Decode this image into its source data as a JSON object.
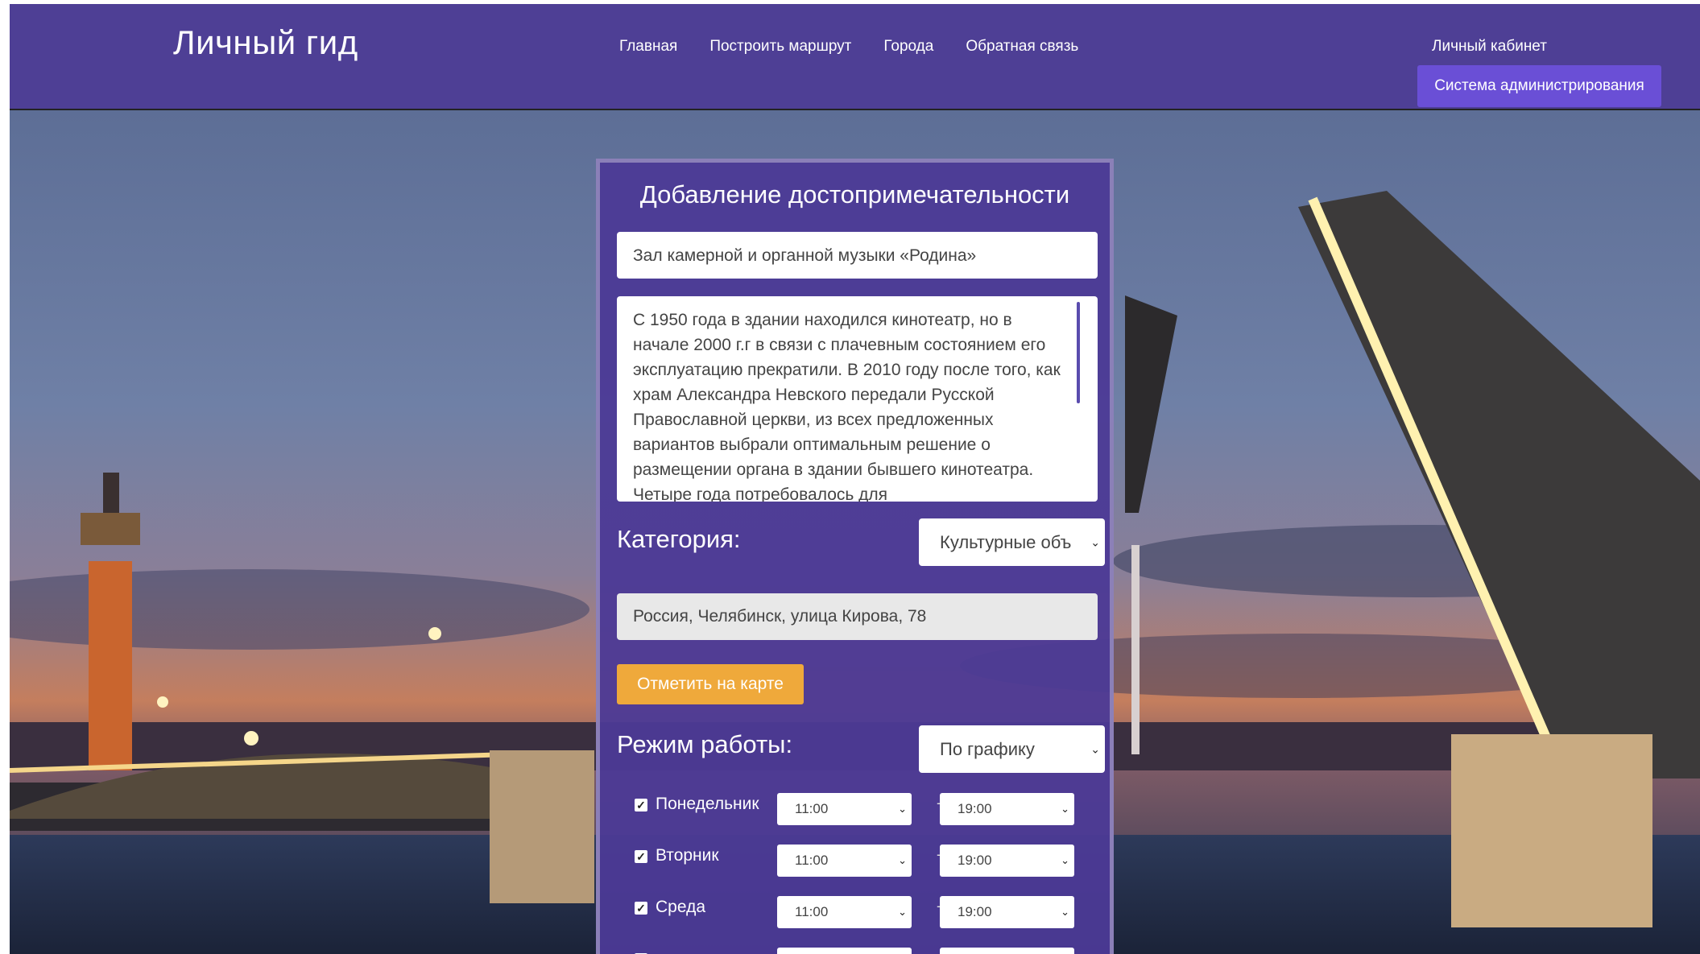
{
  "header": {
    "logo": "Личный гид",
    "nav": [
      "Главная",
      "Построить маршрут",
      "Города",
      "Обратная связь"
    ],
    "cabinet": "Личный кабинет",
    "admin_button": "Система администрирования"
  },
  "form": {
    "title": "Добавление достопримечательности",
    "name_value": "Зал камерной и органной музыки «Родина»",
    "description": "С 1950 года в здании находился кинотеатр, но в начале 2000 г.г в связи с плачевным состоянием его эксплуатацию прекратили. В 2010 году после того, как храм Александра Невского передали Русской Православной церкви, из всех предложенных вариантов выбрали оптимальным решение о размещении органа в здании бывшего кинотеатра. Четыре года потребовалось для",
    "category_label": "Категория:",
    "category_value": "Культурные объ",
    "address_value": "Россия, Челябинск, улица Кирова, 78",
    "map_button": "Отметить на карте",
    "work_label": "Режим работы:",
    "work_value": "По графику",
    "days": [
      {
        "name": "Понедельник",
        "checked": true,
        "from": "11:00",
        "to": "19:00"
      },
      {
        "name": "Вторник",
        "checked": true,
        "from": "11:00",
        "to": "19:00"
      },
      {
        "name": "Среда",
        "checked": true,
        "from": "11:00",
        "to": "19:00"
      }
    ],
    "dash": "-"
  },
  "icons": {
    "dropdown": "chevron-down-icon",
    "checkbox": "checkmark-icon"
  }
}
